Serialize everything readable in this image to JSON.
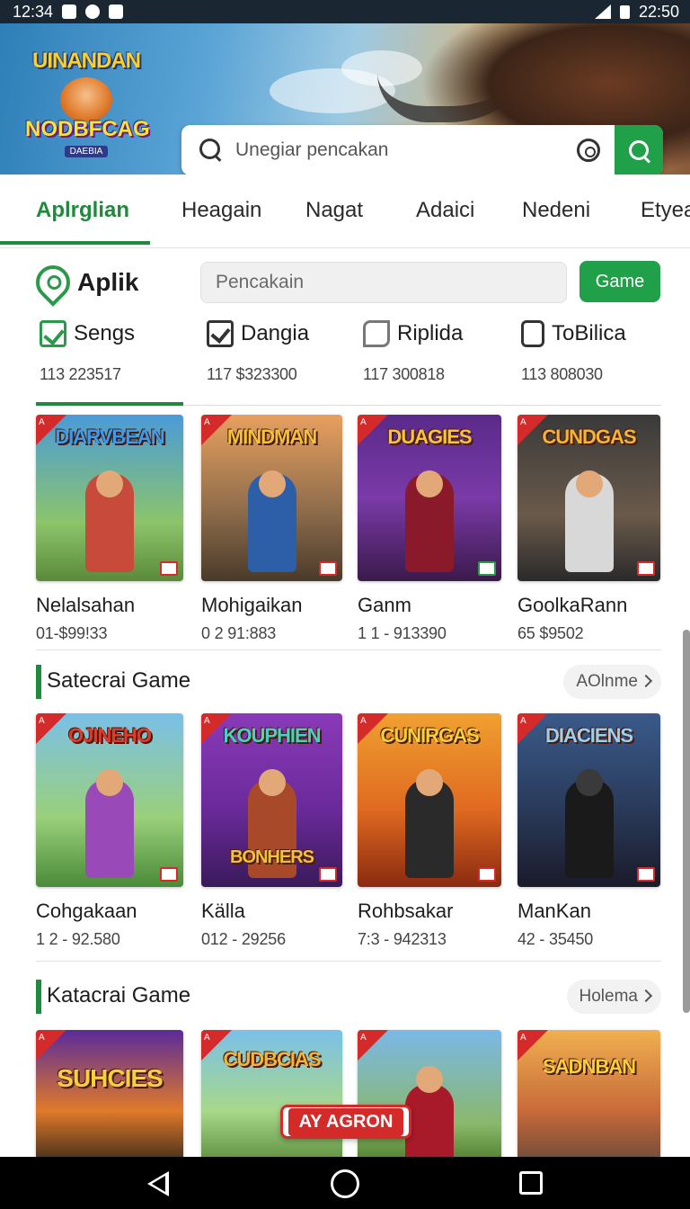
{
  "status_bar": {
    "time_left": "12:34",
    "time_right": "22:50"
  },
  "header": {
    "logo_top": "UINANDAN",
    "logo_mid": "NODBFCAG",
    "logo_sub": "DAEBIA",
    "search_placeholder": "Unegiar pencakan"
  },
  "tabs": [
    {
      "label": "Aplrglian",
      "active": true
    },
    {
      "label": "Heagain"
    },
    {
      "label": "Nagat"
    },
    {
      "label": "Adaici"
    },
    {
      "label": "Nedeni"
    },
    {
      "label": "Etyea"
    }
  ],
  "app_bar": {
    "title": "Aplik",
    "search_placeholder": "Pencakain",
    "game_button": "Game"
  },
  "categories": [
    {
      "label": "Sengs",
      "count": "113 223517",
      "icon": "edit-check-icon"
    },
    {
      "label": "Dangia",
      "count": "117 $323300",
      "icon": "checkbox-icon"
    },
    {
      "label": "Riplida",
      "count": "117 300818",
      "icon": "tag-icon"
    },
    {
      "label": "ToBilica",
      "count": "113 808030",
      "icon": "phone-icon"
    }
  ],
  "featured": [
    {
      "art": "DIARVBEAN",
      "name": "Nelalsahan",
      "price": "01-$99!33",
      "ribbon": "A"
    },
    {
      "art": "MINDMAN",
      "name": "Mohigaikan",
      "price": "0 2 91:883",
      "ribbon": "A"
    },
    {
      "art": "DUAGIES",
      "name": "Ganm",
      "price": "1 1 - 913390",
      "ribbon": "A"
    },
    {
      "art": "CUNDGAS",
      "name": "GoolkaRann",
      "price": "65 $9502",
      "ribbon": "A"
    }
  ],
  "sections": [
    {
      "title": "Satecrai Game",
      "more": "AOlnme",
      "games": [
        {
          "art": "OJINEHO",
          "name": "Cohgakaan",
          "price": "1 2 - 92.580",
          "ribbon": "A"
        },
        {
          "art": "BONHERS",
          "name": "Källa",
          "price": "012 - 29256",
          "ribbon": "A"
        },
        {
          "art": "CUNIRGAS",
          "name": "Rohbsakar",
          "price": "7:3 - 942313",
          "ribbon": "A"
        },
        {
          "art": "DIACIENS",
          "name": "ManKan",
          "price": "42 - 35450",
          "ribbon": "A"
        }
      ]
    },
    {
      "title": "Katacrai Game",
      "more": "Holema",
      "games": [
        {
          "art": "SUHCIES",
          "ribbon": "A"
        },
        {
          "art": "CUDBCIAS",
          "ribbon": "A"
        },
        {
          "art": "",
          "ribbon": "A"
        },
        {
          "art": "SADNBAN",
          "ribbon": "A"
        }
      ]
    }
  ],
  "overlay_button": "AY AGRON"
}
